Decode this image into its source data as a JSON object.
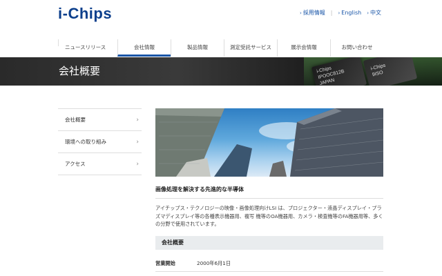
{
  "header": {
    "logo": "i-Chips",
    "util_links": [
      {
        "label": "採用情報"
      },
      {
        "label": "English"
      },
      {
        "label": "中文"
      }
    ]
  },
  "gnav": [
    "ニュースリリース",
    "会社情報",
    "製品情報",
    "測定受託サービス",
    "展示会情報",
    "お問い合わせ"
  ],
  "banner": {
    "title": "会社概要",
    "chip_text_1": "i-Chips\nIPOOC812B\nJAPAN",
    "chip_text_2": "i-Chips\n9ISO"
  },
  "sidebar": [
    "会社概要",
    "環境への取り組み",
    "アクセス"
  ],
  "content": {
    "subheading": "画像処理を解決する先進的な半導体",
    "description": "アイチップス・テクノロジーの映像・画像処理向けLSI は、プロジェクター・液晶ディスプレイ・プラズマディスプレイ等の各種表示機器用、複写 機等のOA機器用、カメラ・検査機等のFA機器用等、多くの分野で使用されています。",
    "section_title": "会社概要",
    "info": [
      {
        "key": "営業開始",
        "value": "2000年6月1日"
      }
    ]
  }
}
